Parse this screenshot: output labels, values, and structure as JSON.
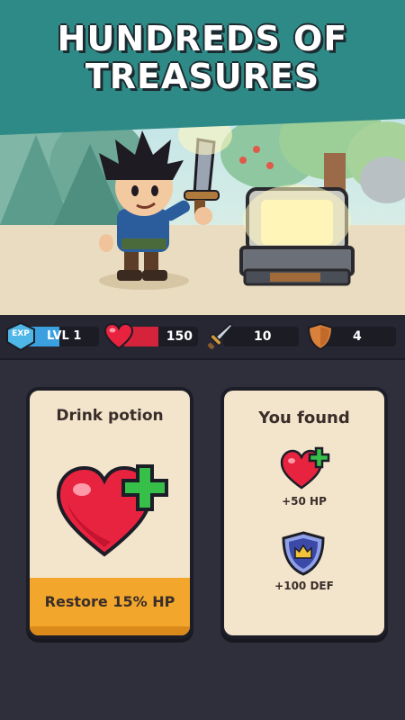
{
  "banner": {
    "title_line1": "HUNDREDS OF",
    "title_line2": "TREASURES"
  },
  "stats": {
    "exp": {
      "badge": "EXP",
      "level": "LVL 1",
      "icon": "exp-shield-icon"
    },
    "health": {
      "value": "150",
      "icon": "heart-icon"
    },
    "attack": {
      "value": "10",
      "icon": "sword-icon"
    },
    "defense": {
      "value": "4",
      "icon": "shield-icon"
    }
  },
  "potion_card": {
    "title": "Drink potion",
    "action": "Restore 15% HP",
    "icon": "heart-plus-icon"
  },
  "found_card": {
    "title": "You found",
    "rewards": [
      {
        "label": "+50 HP",
        "icon": "heart-plus-icon"
      },
      {
        "label": "+100 DEF",
        "icon": "crown-shield-icon"
      }
    ]
  },
  "colors": {
    "banner": "#2e8a86",
    "background": "#2e2f3b",
    "card": "#f3e4cc",
    "action": "#f2a62b",
    "heart": "#e8233f",
    "plus": "#36c04a"
  }
}
